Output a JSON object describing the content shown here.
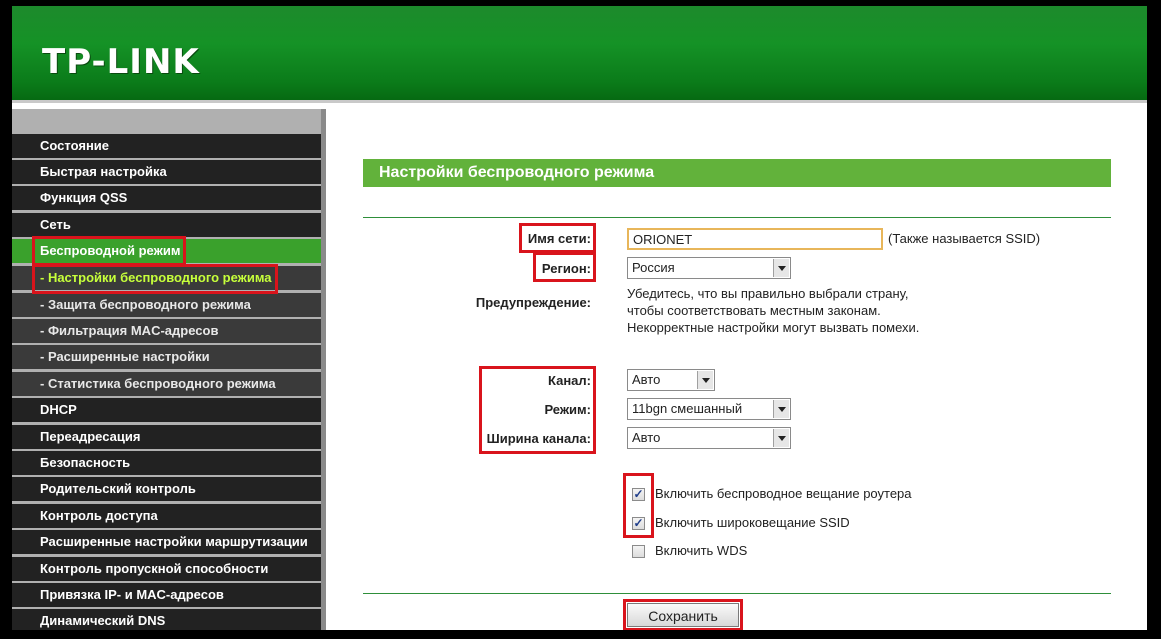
{
  "brand": {
    "logo_text": "TP-LINK"
  },
  "sidebar": {
    "items": [
      {
        "label": "Состояние"
      },
      {
        "label": "Быстрая настройка"
      },
      {
        "label": "Функция QSS"
      },
      {
        "label": "Сеть"
      },
      {
        "label": "Беспроводной режим"
      },
      {
        "label": "- Настройки беспроводного режима"
      },
      {
        "label": "- Защита беспроводного режима"
      },
      {
        "label": "- Фильтрация MAC-адресов"
      },
      {
        "label": "- Расширенные настройки"
      },
      {
        "label": "- Статистика беспроводного режима"
      },
      {
        "label": "DHCP"
      },
      {
        "label": "Переадресация"
      },
      {
        "label": "Безопасность"
      },
      {
        "label": "Родительский контроль"
      },
      {
        "label": "Контроль доступа"
      },
      {
        "label": "Расширенные настройки маршрутизации"
      },
      {
        "label": "Контроль пропускной способности"
      },
      {
        "label": "Привязка IP- и MAC-адресов"
      },
      {
        "label": "Динамический DNS"
      }
    ]
  },
  "page": {
    "title": "Настройки беспроводного режима",
    "ssid": {
      "label": "Имя сети:",
      "value": "ORIONET",
      "hint": "(Также называется SSID)"
    },
    "region": {
      "label": "Регион:",
      "value": "Россия"
    },
    "warning": {
      "label": "Предупреждение:",
      "line1": "Убедитесь, что вы правильно выбрали страну,",
      "line2": "чтобы соответствовать местным законам.",
      "line3": "Некорректные настройки могут вызвать помехи."
    },
    "channel": {
      "label": "Канал:",
      "value": "Авто"
    },
    "mode": {
      "label": "Режим:",
      "value": "11bgn смешанный"
    },
    "width": {
      "label": "Ширина канала:",
      "value": "Авто"
    },
    "checks": {
      "broadcast": {
        "label": "Включить беспроводное вещание роутера",
        "mark": "✓"
      },
      "ssid_broadcast": {
        "label": "Включить широковещание SSID",
        "mark": "✓"
      },
      "wds": {
        "label": "Включить WDS",
        "mark": ""
      }
    },
    "save_label": "Сохранить"
  },
  "colors": {
    "header_green": "#159226",
    "active_nav": "#3aa12c",
    "title_bar": "#62b23b",
    "highlight": "#d9141c",
    "current_sub": "#c6ff3a"
  }
}
